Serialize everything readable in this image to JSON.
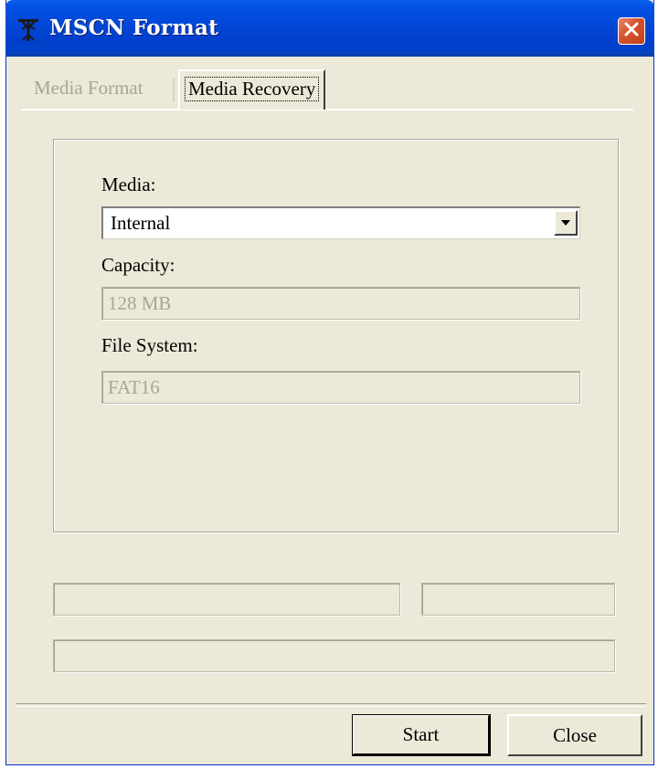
{
  "window": {
    "title": "MSCN Format",
    "close_icon": "close-x-icon",
    "app_icon": "antenna-icon"
  },
  "tabs": [
    {
      "label": "Media Format",
      "active": false
    },
    {
      "label": "Media Recovery",
      "active": true
    }
  ],
  "form": {
    "media_label": "Media:",
    "media_value": "Internal",
    "capacity_label": "Capacity:",
    "capacity_value": "128 MB",
    "filesystem_label": "File System:",
    "filesystem_value": "FAT16"
  },
  "buttons": {
    "start_label": "Start",
    "close_label": "Close"
  },
  "colors": {
    "titlebar": "#0248d8",
    "window_bg": "#ece9d8",
    "close_button": "#d4522d",
    "disabled_text": "#a7a596"
  }
}
